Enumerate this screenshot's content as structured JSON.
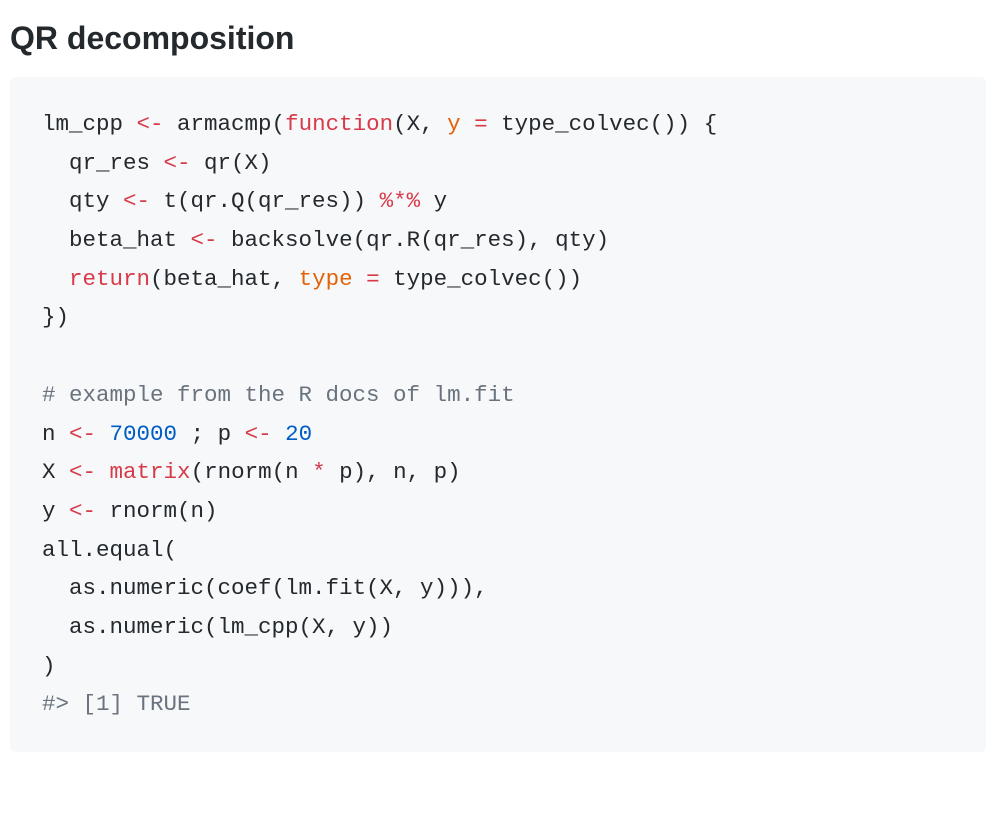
{
  "heading": "QR decomposition",
  "code": {
    "tokens": [
      [
        {
          "t": "lm_cpp ",
          "c": "tok-default"
        },
        {
          "t": "<-",
          "c": "tok-op"
        },
        {
          "t": " armacmp(",
          "c": "tok-default"
        },
        {
          "t": "function",
          "c": "tok-kw"
        },
        {
          "t": "(X, ",
          "c": "tok-default"
        },
        {
          "t": "y",
          "c": "tok-arg"
        },
        {
          "t": " ",
          "c": "tok-default"
        },
        {
          "t": "=",
          "c": "tok-op"
        },
        {
          "t": " type_colvec()) {",
          "c": "tok-default"
        }
      ],
      [
        {
          "t": "  qr_res ",
          "c": "tok-default"
        },
        {
          "t": "<-",
          "c": "tok-op"
        },
        {
          "t": " qr(X)",
          "c": "tok-default"
        }
      ],
      [
        {
          "t": "  qty ",
          "c": "tok-default"
        },
        {
          "t": "<-",
          "c": "tok-op"
        },
        {
          "t": " t(qr.Q(qr_res)) ",
          "c": "tok-default"
        },
        {
          "t": "%*%",
          "c": "tok-op"
        },
        {
          "t": " y",
          "c": "tok-default"
        }
      ],
      [
        {
          "t": "  beta_hat ",
          "c": "tok-default"
        },
        {
          "t": "<-",
          "c": "tok-op"
        },
        {
          "t": " backsolve(qr.R(qr_res), qty)",
          "c": "tok-default"
        }
      ],
      [
        {
          "t": "  ",
          "c": "tok-default"
        },
        {
          "t": "return",
          "c": "tok-kw"
        },
        {
          "t": "(beta_hat, ",
          "c": "tok-default"
        },
        {
          "t": "type",
          "c": "tok-arg"
        },
        {
          "t": " ",
          "c": "tok-default"
        },
        {
          "t": "=",
          "c": "tok-op"
        },
        {
          "t": " type_colvec())",
          "c": "tok-default"
        }
      ],
      [
        {
          "t": "})",
          "c": "tok-default"
        }
      ],
      [
        {
          "t": "",
          "c": "tok-default"
        }
      ],
      [
        {
          "t": "# example from the R docs of lm.fit",
          "c": "tok-com"
        }
      ],
      [
        {
          "t": "n ",
          "c": "tok-default"
        },
        {
          "t": "<-",
          "c": "tok-op"
        },
        {
          "t": " ",
          "c": "tok-default"
        },
        {
          "t": "70000",
          "c": "tok-num"
        },
        {
          "t": " ; p ",
          "c": "tok-default"
        },
        {
          "t": "<-",
          "c": "tok-op"
        },
        {
          "t": " ",
          "c": "tok-default"
        },
        {
          "t": "20",
          "c": "tok-num"
        }
      ],
      [
        {
          "t": "X ",
          "c": "tok-default"
        },
        {
          "t": "<-",
          "c": "tok-op"
        },
        {
          "t": " ",
          "c": "tok-default"
        },
        {
          "t": "matrix",
          "c": "tok-builtin"
        },
        {
          "t": "(rnorm(n ",
          "c": "tok-default"
        },
        {
          "t": "*",
          "c": "tok-op"
        },
        {
          "t": " p), n, p)",
          "c": "tok-default"
        }
      ],
      [
        {
          "t": "y ",
          "c": "tok-default"
        },
        {
          "t": "<-",
          "c": "tok-op"
        },
        {
          "t": " rnorm(n)",
          "c": "tok-default"
        }
      ],
      [
        {
          "t": "all.equal(",
          "c": "tok-default"
        }
      ],
      [
        {
          "t": "  as.numeric(coef(lm.fit(X, y))),",
          "c": "tok-default"
        }
      ],
      [
        {
          "t": "  as.numeric(lm_cpp(X, y))",
          "c": "tok-default"
        }
      ],
      [
        {
          "t": ")",
          "c": "tok-default"
        }
      ],
      [
        {
          "t": "#> [1] TRUE",
          "c": "tok-com"
        }
      ]
    ]
  }
}
